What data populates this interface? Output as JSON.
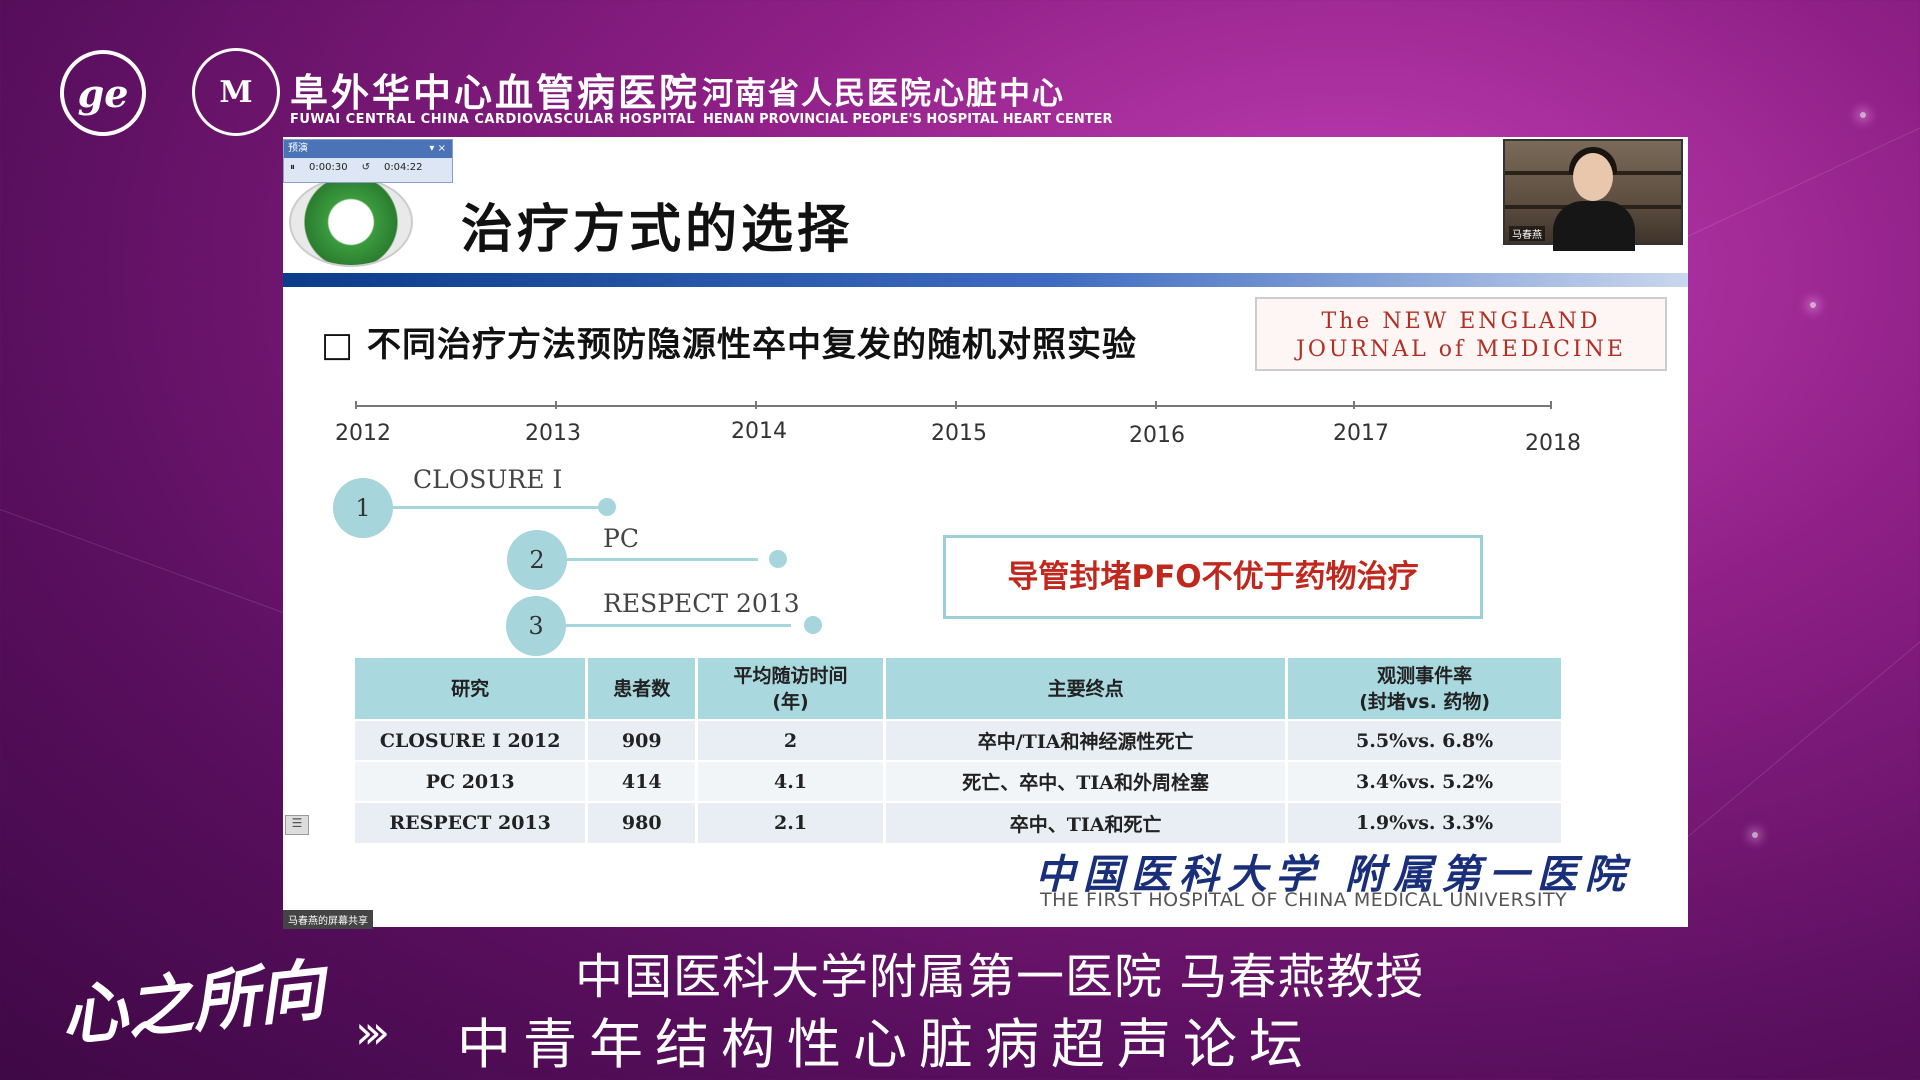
{
  "header": {
    "ge_logo_text": "ge",
    "hosp_logo_text": "M",
    "hospital_cn": "阜外华中心血管病医院",
    "hospital_en": "FUWAI CENTRAL CHINA CARDIOVASCULAR HOSPITAL",
    "henan_cn": "河南省人民医院心脏中心",
    "henan_en": "HENAN PROVINCIAL PEOPLE'S HOSPITAL HEART CENTER"
  },
  "ppt_control": {
    "title": "预演",
    "elapsed": "0:00:30",
    "total": "0:04:22"
  },
  "webcam": {
    "name": "马春燕"
  },
  "slide": {
    "title": "治疗方式的选择",
    "bullet": "□  不同治疗方法预防隐源性卒中复发的随机对照实验",
    "nejm_line1": "The NEW ENGLAND",
    "nejm_line2": "JOURNAL of MEDICINE",
    "years": [
      "2012",
      "2013",
      "2014",
      "2015",
      "2016",
      "2017",
      "2018"
    ],
    "trials": [
      {
        "num": "1",
        "label": "CLOSURE I"
      },
      {
        "num": "2",
        "label": "PC"
      },
      {
        "num": "3",
        "label": "RESPECT 2013"
      }
    ],
    "conclusion": "导管封堵PFO不优于药物治疗",
    "table": {
      "headers": [
        "研究",
        "患者数",
        "平均随访时间\n(年)",
        "主要终点",
        "观测事件率\n(封堵vs. 药物)"
      ],
      "rows": [
        [
          "CLOSURE I 2012",
          "909",
          "2",
          "卒中/TIA和神经源性死亡",
          "5.5%vs. 6.8%"
        ],
        [
          "PC 2013",
          "414",
          "4.1",
          "死亡、卒中、TIA和外周栓塞",
          "3.4%vs. 5.2%"
        ],
        [
          "RESPECT 2013",
          "980",
          "2.1",
          "卒中、TIA和死亡",
          "1.9%vs. 3.3%"
        ]
      ]
    },
    "cmu_cn": "中国医科大学 附属第一医院",
    "cmu_en": "THE FIRST HOSPITAL OF CHINA MEDICAL UNIVERSITY"
  },
  "share_tag": "马春燕的屏幕共享",
  "footer": {
    "speaker": "中国医科大学附属第一医院 马春燕教授",
    "forum": "中青年结构性心脏病超声论坛",
    "arrows": "›››",
    "brand": "心之所向"
  }
}
